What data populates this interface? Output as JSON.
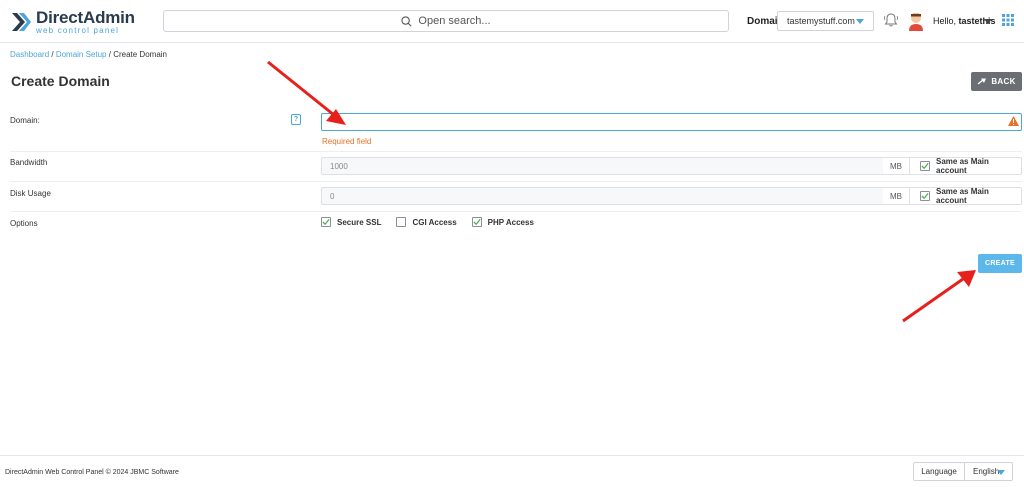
{
  "header": {
    "logo_title": "DirectAdmin",
    "logo_subtitle": "web control panel",
    "search_placeholder": "Open search...",
    "domain_label": "Domain",
    "domain_value": "tastemystuff.com",
    "greeting": "Hello,",
    "username": "tastethis",
    "icons": [
      "search-icon",
      "bell-icon",
      "avatar",
      "apps-grid-icon"
    ]
  },
  "breadcrumb": {
    "items": [
      "Dashboard",
      "Domain Setup",
      "Create Domain"
    ],
    "separator": " / "
  },
  "page": {
    "title": "Create Domain",
    "back_label": "BACK"
  },
  "form": {
    "domain": {
      "label": "Domain:",
      "help": "?",
      "value": "",
      "error": "Required field"
    },
    "bandwidth": {
      "label": "Bandwidth",
      "value": "1000",
      "unit": "MB",
      "same_label": "Same as Main account",
      "same_checked": true
    },
    "disk_usage": {
      "label": "Disk Usage",
      "value": "0",
      "unit": "MB",
      "same_label": "Same as Main account",
      "same_checked": true
    },
    "options": {
      "label": "Options",
      "items": [
        {
          "label": "Secure SSL",
          "checked": true
        },
        {
          "label": "CGI Access",
          "checked": false
        },
        {
          "label": "PHP Access",
          "checked": true
        }
      ]
    },
    "create_label": "CREATE"
  },
  "footer": {
    "copyright": "DirectAdmin Web Control Panel © 2024 JBMC Software",
    "language_label": "Language",
    "language_value": "English"
  },
  "colors": {
    "accent": "#4da5d9",
    "create_button": "#5cb8ea",
    "back_button": "#6b6f73",
    "error": "#e8702a",
    "annotation_arrow": "#e8201c",
    "check": "#4caf50"
  }
}
